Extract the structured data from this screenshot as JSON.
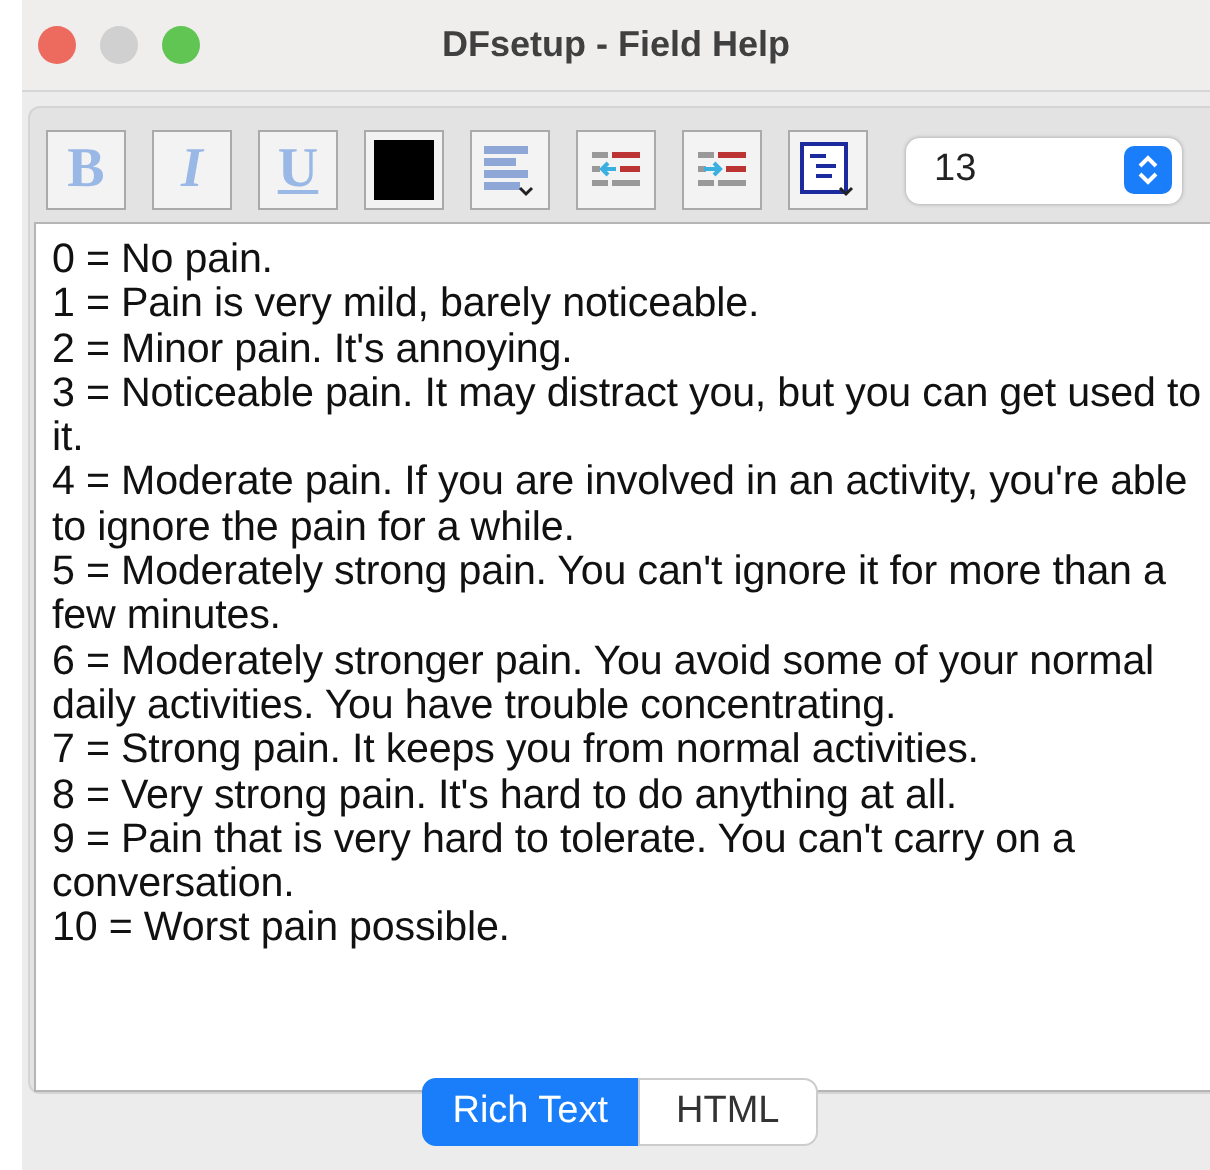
{
  "window": {
    "title": "DFsetup - Field Help"
  },
  "toolbar": [
    {
      "kind": "bold",
      "label": "B"
    },
    {
      "kind": "italic",
      "label": "I"
    },
    {
      "kind": "underline",
      "label": "U"
    },
    {
      "kind": "color",
      "color": "#000000"
    },
    {
      "kind": "align"
    },
    {
      "kind": "outdent"
    },
    {
      "kind": "indent"
    },
    {
      "kind": "list"
    }
  ],
  "font_size": {
    "value": "13"
  },
  "editor": {
    "lines": [
      "0 = No pain.",
      "1 = Pain is very mild, barely noticeable.",
      "2 = Minor pain. It's annoying.",
      "3 = Noticeable pain. It may distract you, but you can get used to it.",
      "4 = Moderate pain. If you are involved in an activity, you're able to ignore the pain for a while.",
      "5 = Moderately strong pain. You can't ignore it for more than a few minutes.",
      "6 = Moderately stronger pain.  You avoid some of your normal daily activities. You have trouble concentrating.",
      "7 = Strong pain. It keeps you from normal activities.",
      "8 = Very strong pain. It's hard to do anything at all.",
      "9 = Pain that is very hard to tolerate. You can't carry on a conversation.",
      "10 = Worst pain possible."
    ]
  },
  "tabs": [
    {
      "label": "Rich Text",
      "selected": true
    },
    {
      "label": "HTML",
      "selected": false
    }
  ]
}
